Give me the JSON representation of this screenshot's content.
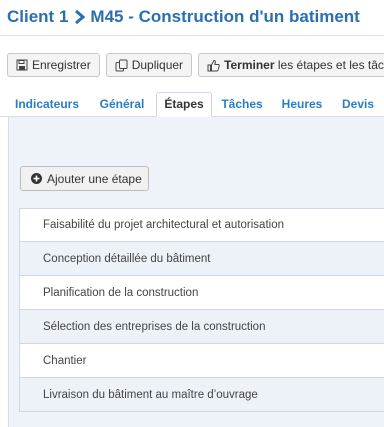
{
  "header": {
    "client": "Client 1",
    "project": "M45 - Construction d'un batiment"
  },
  "toolbar": {
    "save_label": "Enregistrer",
    "duplicate_label": "Dupliquer",
    "finish_bold": "Terminer",
    "finish_rest": " les étapes et les tâch"
  },
  "tabs": [
    {
      "label": "Indicateurs"
    },
    {
      "label": "Général"
    },
    {
      "label": "Étapes"
    },
    {
      "label": "Tâches"
    },
    {
      "label": "Heures"
    },
    {
      "label": "Devis"
    }
  ],
  "active_tab": "Étapes",
  "add_step_label": "Ajouter une étape",
  "steps": [
    {
      "label": "Faisabilité du projet architectural et autorisation"
    },
    {
      "label": "Conception détaillée du bâtiment"
    },
    {
      "label": "Planification de la construction"
    },
    {
      "label": "Sélection des entreprises de la construction"
    },
    {
      "label": "Chantier"
    },
    {
      "label": "Livraison du bâtiment au maître d’ouvrage"
    }
  ],
  "colors": {
    "title": "#2a6fb0",
    "tab_link": "#2a7ec0",
    "panel_bg": "#eef3fa"
  }
}
